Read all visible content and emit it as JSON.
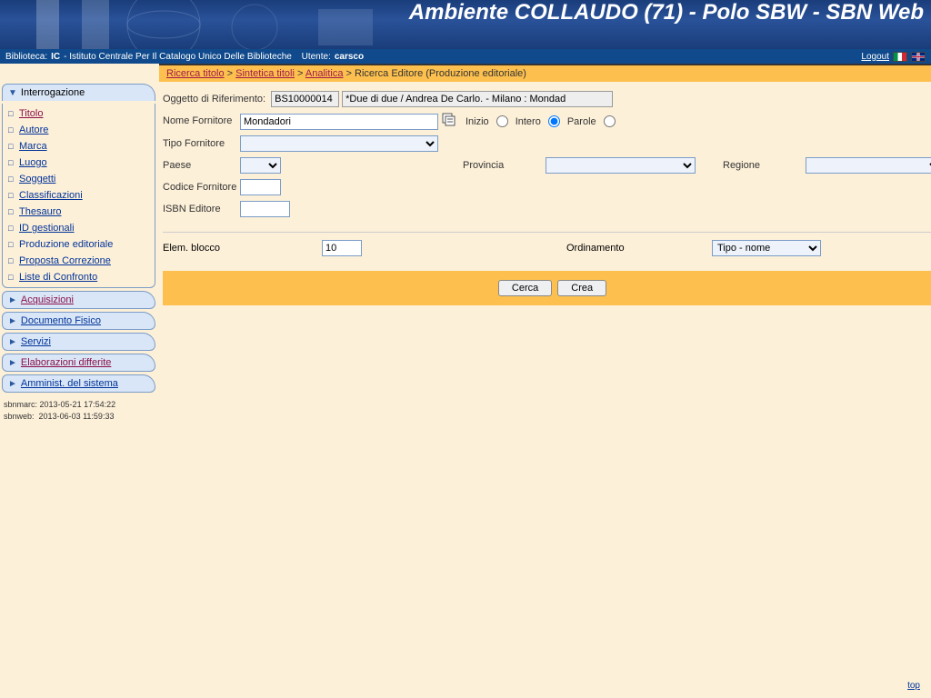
{
  "header": {
    "title": "Ambiente COLLAUDO (71) - Polo SBW - SBN Web"
  },
  "infobar": {
    "biblioteca_label": "Biblioteca:",
    "biblioteca_code": "IC",
    "biblioteca_name": " - Istituto Centrale Per Il Catalogo Unico Delle Biblioteche",
    "utente_label": "Utente:",
    "utente": "carsco",
    "logout": "Logout"
  },
  "breadcrumb": {
    "items": [
      "Ricerca titolo",
      "Sintetica titoli",
      "Analitica"
    ],
    "sep": " > ",
    "current": "Ricerca Editore (Produzione editoriale)"
  },
  "sidebar": {
    "interrogazione": "Interrogazione",
    "items": [
      {
        "label": "Titolo",
        "visited": true
      },
      {
        "label": "Autore",
        "visited": false
      },
      {
        "label": "Marca",
        "visited": false
      },
      {
        "label": "Luogo",
        "visited": false
      },
      {
        "label": "Soggetti",
        "visited": false
      },
      {
        "label": "Classificazioni",
        "visited": false
      },
      {
        "label": "Thesauro",
        "visited": false
      },
      {
        "label": "ID gestionali",
        "visited": false
      },
      {
        "label": "Produzione editoriale",
        "visited": false,
        "current": true
      },
      {
        "label": "Proposta Correzione",
        "visited": false
      },
      {
        "label": "Liste di Confronto",
        "visited": false
      }
    ],
    "sections": [
      {
        "label": "Acquisizioni",
        "visited": true
      },
      {
        "label": "Documento Fisico",
        "visited": false
      },
      {
        "label": "Servizi",
        "visited": false
      },
      {
        "label": "Elaborazioni differite",
        "visited": true
      },
      {
        "label": "Amminist. del sistema",
        "visited": false
      }
    ],
    "ts1_label": "sbnmarc:",
    "ts1": "2013-05-21 17:54:22",
    "ts2_label": "sbnweb:",
    "ts2": "2013-06-03 11:59:33"
  },
  "form": {
    "oggetto_label": "Oggetto di Riferimento:",
    "oggetto_code": "BS10000014",
    "oggetto_desc": "*Due di due / Andrea De Carlo. - Milano : Mondad",
    "nome_label": "Nome Fornitore",
    "nome_value": "Mondadori",
    "inizio": "Inizio",
    "intero": "Intero",
    "parole": "Parole",
    "tipo_label": "Tipo Fornitore",
    "paese_label": "Paese",
    "provincia_label": "Provincia",
    "regione_label": "Regione",
    "codice_label": "Codice Fornitore",
    "isbn_label": "ISBN Editore",
    "elem_label": "Elem. blocco",
    "elem_value": "10",
    "ord_label": "Ordinamento",
    "ord_value": "Tipo - nome",
    "btn_cerca": "Cerca",
    "btn_crea": "Crea"
  },
  "footer": {
    "top": "top"
  }
}
